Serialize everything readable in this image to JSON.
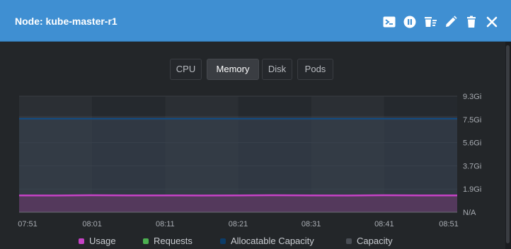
{
  "header": {
    "title": "Node: kube-master-r1",
    "icons": [
      "terminal-icon",
      "pause-icon",
      "drain-icon",
      "edit-icon",
      "delete-icon",
      "close-icon"
    ]
  },
  "tabs": [
    {
      "label": "CPU",
      "active": false
    },
    {
      "label": "Memory",
      "active": true
    },
    {
      "label": "Disk",
      "active": false
    },
    {
      "label": "Pods",
      "active": false
    }
  ],
  "colors": {
    "header": "#3f8fd2",
    "usage": "#c542c5",
    "requests": "#4caf50",
    "allocatable": "#0d3c68",
    "capacity": "#4a4e55"
  },
  "legend": [
    {
      "label": "Usage",
      "color": "#c542c5"
    },
    {
      "label": "Requests",
      "color": "#4caf50"
    },
    {
      "label": "Allocatable Capacity",
      "color": "#0d3c68"
    },
    {
      "label": "Capacity",
      "color": "#4a4e55"
    }
  ],
  "chart_data": {
    "type": "area",
    "x": [
      "07:51",
      "08:01",
      "08:11",
      "08:21",
      "08:31",
      "08:41",
      "08:51"
    ],
    "y_ticks": [
      "9.3Gi",
      "7.5Gi",
      "5.6Gi",
      "3.7Gi",
      "1.9Gi",
      "N/A"
    ],
    "y_unit": "Gi",
    "ylim": [
      0,
      9.3
    ],
    "grid": true,
    "legend_position": "bottom",
    "series": [
      {
        "name": "Usage",
        "values": [
          1.35,
          1.34,
          1.36,
          1.35,
          1.35,
          1.34,
          1.35,
          1.36,
          1.35,
          1.34,
          1.36,
          1.35,
          1.35
        ]
      },
      {
        "name": "Allocatable Capacity",
        "values": [
          7.5,
          7.5,
          7.5,
          7.5,
          7.5,
          7.5,
          7.5,
          7.5,
          7.5,
          7.5,
          7.5,
          7.5,
          7.5
        ]
      },
      {
        "name": "Capacity",
        "values": [
          7.7,
          7.7,
          7.7,
          7.7,
          7.7,
          7.7,
          7.7,
          7.7,
          7.7,
          7.7,
          7.7,
          7.7,
          7.7
        ]
      }
    ]
  }
}
